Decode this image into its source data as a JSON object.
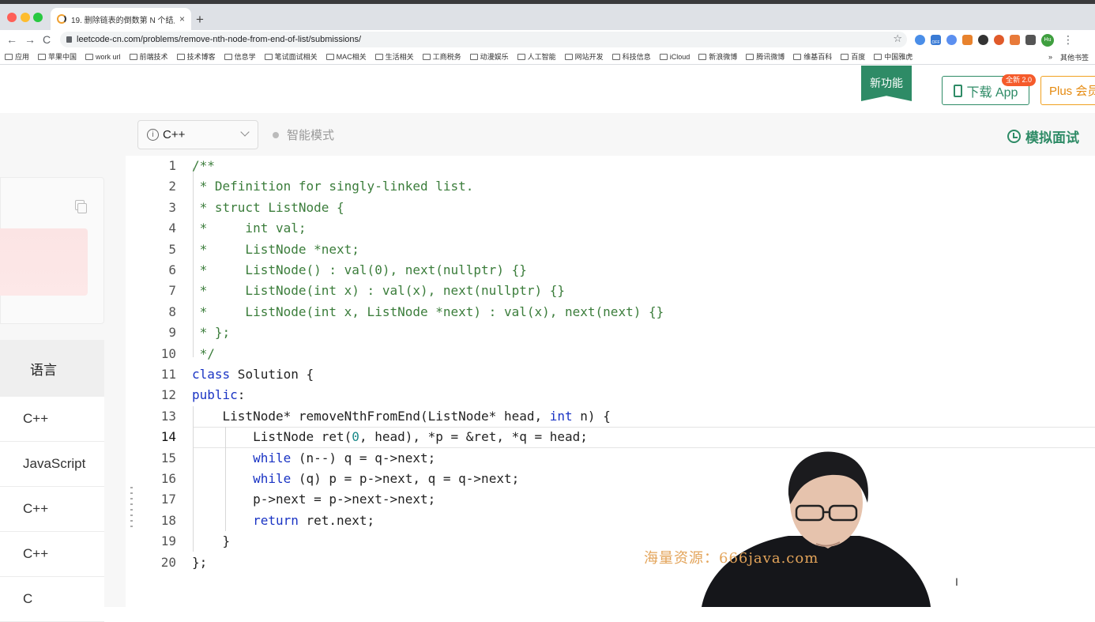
{
  "browser": {
    "tab_title": "19. 删除链表的倒数第 N 个结点 -",
    "tab_close": "×",
    "new_tab": "+",
    "back": "←",
    "forward": "→",
    "reload": "C",
    "url": "leetcode-cn.com/problems/remove-nth-node-from-end-of-list/submissions/",
    "star": "☆",
    "profile_initials": "Hu",
    "extension_badge": "OFF",
    "menu": "⋮",
    "bookmarks": [
      "应用",
      "苹果中国",
      "work url",
      "前端技术",
      "技术博客",
      "信息学",
      "笔试面试相关",
      "MAC相关",
      "生活相关",
      "工商税务",
      "动漫娱乐",
      "人工智能",
      "网站开发",
      "科技信息",
      "iCloud",
      "新浪微博",
      "腾讯微博",
      "维基百科",
      "百度",
      "中国雅虎"
    ],
    "bookmarks_more": "»",
    "bookmarks_other": "其他书签"
  },
  "header": {
    "new_feature": "新功能",
    "download_app": "下载 App",
    "badge_new": "全新 2.0",
    "plus_vip": "Plus 会员"
  },
  "toolbar": {
    "language": "C++",
    "info_symbol": "i",
    "smart_mode": "智能模式",
    "mock_interview": "模拟面试"
  },
  "left_panel": {
    "language_header": "语言",
    "languages": [
      "C++",
      "JavaScript",
      "C++",
      "C++",
      "C"
    ]
  },
  "editor": {
    "line_numbers": [
      "1",
      "2",
      "3",
      "4",
      "5",
      "6",
      "7",
      "8",
      "9",
      "10",
      "11",
      "12",
      "13",
      "14",
      "15",
      "16",
      "17",
      "18",
      "19",
      "20"
    ],
    "lines": [
      "/**",
      " * Definition for singly-linked list.",
      " * struct ListNode {",
      " *     int val;",
      " *     ListNode *next;",
      " *     ListNode() : val(0), next(nullptr) {}",
      " *     ListNode(int x) : val(x), next(nullptr) {}",
      " *     ListNode(int x, ListNode *next) : val(x), next(next) {}",
      " * };",
      " */",
      "class Solution {",
      "public:",
      "    ListNode* removeNthFromEnd(ListNode* head, int n) {",
      "        ListNode ret(0, head), *p = &ret, *q = head;",
      "        while (n--) q = q->next;",
      "        while (q) p = p->next, q = q->next;",
      "        p->next = p->next->next;",
      "        return ret.next;",
      "    }",
      "};"
    ],
    "current_line": 14
  },
  "overlay": {
    "watermark": "海量资源：666java.com",
    "text_cursor": "I"
  }
}
